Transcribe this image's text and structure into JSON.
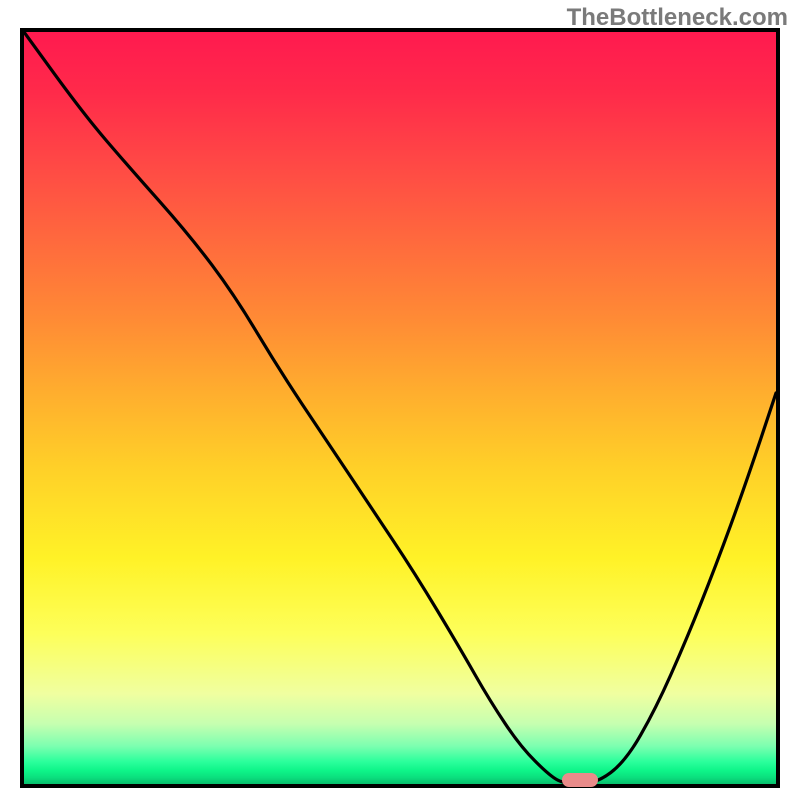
{
  "watermark": "TheBottleneck.com",
  "colors": {
    "gradient_top": "#ff1a4f",
    "gradient_mid": "#fff227",
    "gradient_bottom": "#08c06d",
    "curve": "#000000",
    "marker": "#e98b8a",
    "border": "#000000"
  },
  "chart_data": {
    "type": "line",
    "title": "",
    "xlabel": "",
    "ylabel": "",
    "xlim": [
      0,
      100
    ],
    "ylim": [
      0,
      100
    ],
    "grid": false,
    "note": "Axes are unlabeled in the original chart; values are estimated from pixel positions (y=0 bottom, y=100 top). The curve is rendered against a vertical red→yellow→green gradient background.",
    "series": [
      {
        "name": "bottleneck-curve",
        "x": [
          0,
          8,
          14,
          22,
          28,
          34,
          40,
          46,
          52,
          58,
          62,
          66,
          70,
          72,
          76,
          80,
          84,
          88,
          92,
          96,
          100
        ],
        "y": [
          100,
          89,
          82,
          73,
          65,
          55,
          46,
          37,
          28,
          18,
          11,
          5,
          1,
          0,
          0,
          3,
          10,
          19,
          29,
          40,
          52
        ]
      }
    ],
    "marker": {
      "x": 74,
      "y": 0.5,
      "shape": "pill",
      "color": "#e98b8a"
    },
    "background_gradient": {
      "direction": "top-to-bottom",
      "stops": [
        {
          "pos": 0.0,
          "color": "#ff1a4f"
        },
        {
          "pos": 0.38,
          "color": "#ff8a35"
        },
        {
          "pos": 0.7,
          "color": "#fff227"
        },
        {
          "pos": 0.92,
          "color": "#c6ffb0"
        },
        {
          "pos": 1.0,
          "color": "#08c06d"
        }
      ]
    }
  }
}
